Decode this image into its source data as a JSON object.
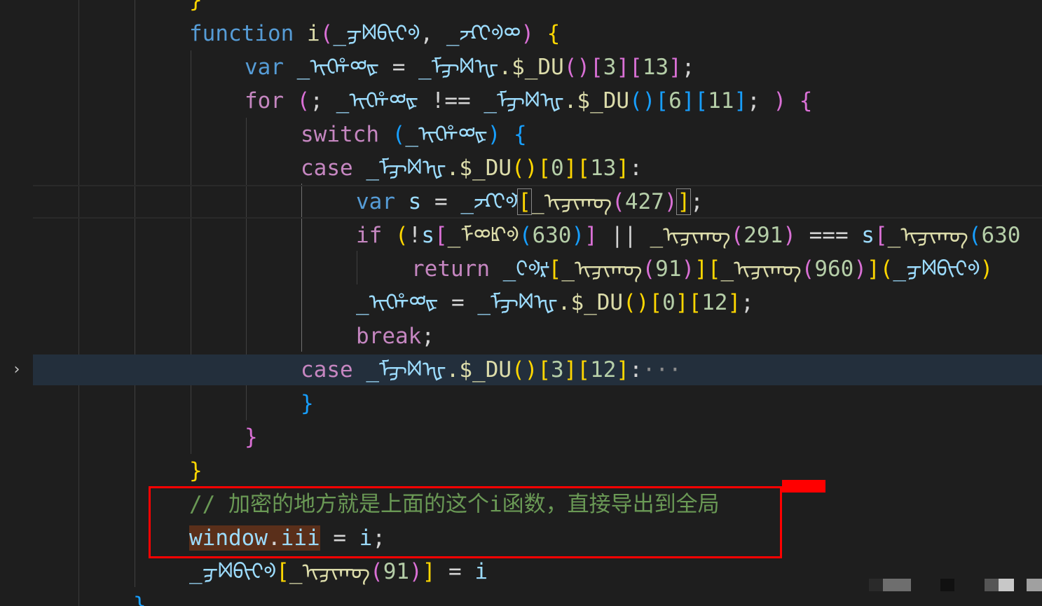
{
  "editor": {
    "lines": {
      "l0": {
        "brace": "}"
      },
      "l1": {
        "keyword": "function",
        "name": "i",
        "lparen": "(",
        "p1": "_ᢖᢂᡋᡳᢗᢀ",
        "comma": ", ",
        "p2": "_ᡔᡗᢗᢀᢁ",
        "rparen": ")",
        "lbrace": " {"
      },
      "l2": {
        "keyword": "var",
        "lhs": " _ᡞᢗᡥᢁᡃᢘ",
        "eq": " = ",
        "obj": "_ᡏᢖᢂᡙ",
        "member": ".$_DU",
        "call": "()",
        "idx1o": "[",
        "idx1": "3",
        "idx1c": "]",
        "idx2o": "[",
        "idx2": "13",
        "idx2c": "]",
        "end": ";"
      },
      "l3": {
        "keyword": "for",
        "lparen": " (",
        "semi": "; ",
        "lhs": "_ᡞᢗᡥᢁᡃᢘ",
        "neq": " !== ",
        "obj": "_ᡏᢖᢂᡙ",
        "member": ".$_DU",
        "call": "()",
        "idx1o": "[",
        "idx1": "6",
        "idx1c": "]",
        "idx2o": "[",
        "idx2": "11",
        "idx2c": "]",
        "semi2": "; ",
        "rparen": ")",
        "lbrace": " {"
      },
      "l4": {
        "keyword": "switch",
        "lparen": " (",
        "arg": "_ᡞᢗᡥᢁᡃᢘ",
        "rparen": ")",
        "lbrace": " {"
      },
      "l5": {
        "keyword": "case",
        "obj": " _ᡏᢖᢂᡙ",
        "member": ".$_DU",
        "call": "()",
        "idx1o": "[",
        "idx1": "0",
        "idx1c": "]",
        "idx2o": "[",
        "idx2": "13",
        "idx2c": "]",
        "colon": ":"
      },
      "l6": {
        "keyword": "var",
        "lhs": " s",
        "eq": " = ",
        "obj": "_ᡔᡗᢗᢀᡃ",
        "lbr": "[",
        "fn": "_ᡞᢖᡞᡴᡋ",
        "lp": "(",
        "num": "427",
        "rp": ")",
        "rbr": "]",
        "end": ";"
      },
      "l7": {
        "keyword": "if",
        "lparen": " (",
        "not": "!",
        "s": "s",
        "lbr": "[",
        "fn": "_ᡏᢁᡌᢀ",
        "lp": "(",
        "num": "630",
        "rp": ")",
        "rbr": "]",
        "or": " || ",
        "fn2": "_ᡞᢖᡞᡴᡋ",
        "lp2": "(",
        "num2": "291",
        "rp2": ")",
        "eqeq": " === ",
        "s2": "s",
        "lbr2": "[",
        "fn3": "_ᡞᢖᡞᡴᡋ",
        "lp3": "(",
        "num3": "630"
      },
      "l8": {
        "keyword": "return",
        "obj": " _ᢗᢀᡃᡵᡃ",
        "lbr": "[",
        "fn": "_ᡞᢖᡞᡴᡋ",
        "lp": "(",
        "num": "91",
        "rp": ")",
        "rbr": "]",
        "lbr2": "[",
        "fn2": "_ᡞᢖᡞᡴᡋ",
        "lp2": "(",
        "num2": "960",
        "rp2": ")",
        "rbr2": "]",
        "lp3": "(",
        "arg": "_ᢖᢂᡋᡳᢗᢀ",
        "rp3": ")"
      },
      "l9": {
        "lhs": "_ᡞᢗᡥᢁᡃᢘ",
        "eq": " = ",
        "obj": "_ᡏᢖᢂᡙ",
        "member": ".$_DU",
        "call": "()",
        "idx1o": "[",
        "idx1": "0",
        "idx1c": "]",
        "idx2o": "[",
        "idx2": "12",
        "idx2c": "]",
        "end": ";"
      },
      "l10": {
        "keyword": "break",
        "end": ";"
      },
      "l11": {
        "keyword": "case",
        "obj": " _ᡏᢖᢂᡙ",
        "member": ".$_DU",
        "call": "()",
        "idx1o": "[",
        "idx1": "3",
        "idx1c": "]",
        "idx2o": "[",
        "idx2": "12",
        "idx2c": "]",
        "colon": ":",
        "ellipsis": "···"
      },
      "l12": {
        "brace": "}"
      },
      "l13": {
        "brace": "}"
      },
      "l14": {
        "brace": "}"
      },
      "l15": {
        "comment": "// 加密的地方就是上面的这个i函数，直接导出到全局"
      },
      "l16": {
        "obj": "window",
        "dot": ".",
        "prop": "iii",
        "eq": " = ",
        "val": "i",
        "end": ";"
      },
      "l17": {
        "obj": "_ᢖᢂᡋᡳᢗᢀ",
        "lbr": "[",
        "fn": "_ᡞᢖᡞᡴᡋ",
        "lp": "(",
        "num": "91",
        "rp": ")",
        "rbr": "]",
        "eq": " = ",
        "val": "i"
      },
      "l18": {
        "brace": "}"
      }
    },
    "fold_glyph": "›",
    "colors": {
      "background": "#1e1e1e",
      "keyword_blue": "#569cd6",
      "keyword_purple": "#c586c0",
      "function_yellow": "#dcdcaa",
      "variable": "#9cdcfe",
      "number": "#b5cea8",
      "comment": "#6a9955",
      "highlight_line": "#232f3c",
      "annotation_red": "#ff0000"
    }
  }
}
